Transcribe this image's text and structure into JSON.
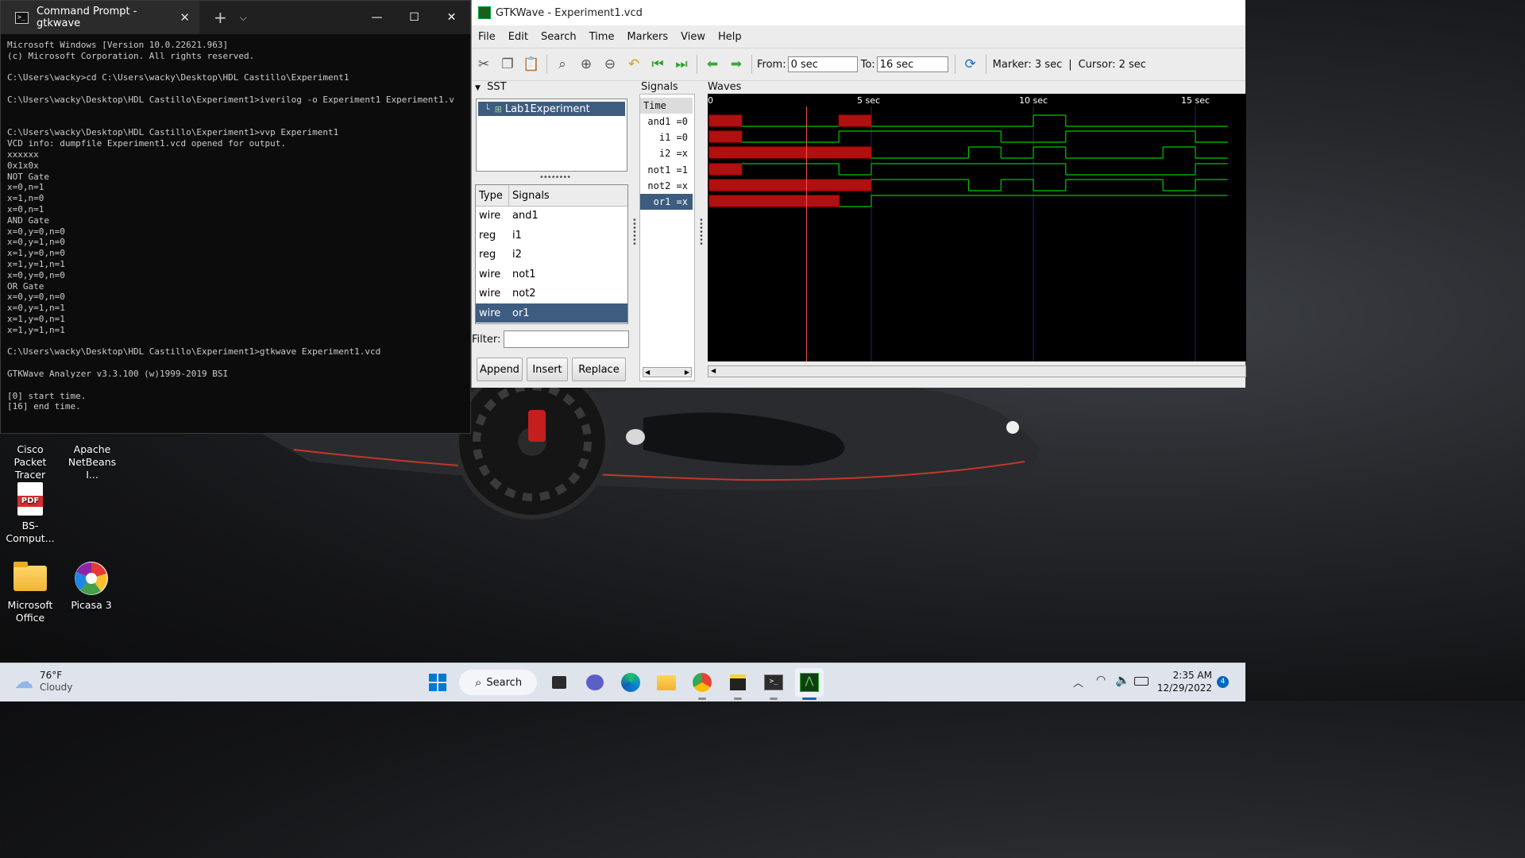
{
  "cmd": {
    "tab_title": "Command Prompt - gtkwave",
    "lines": [
      "Microsoft Windows [Version 10.0.22621.963]",
      "(c) Microsoft Corporation. All rights reserved.",
      "",
      "C:\\Users\\wacky>cd C:\\Users\\wacky\\Desktop\\HDL Castillo\\Experiment1",
      "",
      "C:\\Users\\wacky\\Desktop\\HDL Castillo\\Experiment1>iverilog -o Experiment1 Experiment1.v",
      "",
      "",
      "C:\\Users\\wacky\\Desktop\\HDL Castillo\\Experiment1>vvp Experiment1",
      "VCD info: dumpfile Experiment1.vcd opened for output.",
      "xxxxxx",
      "0x1x0x",
      "NOT Gate",
      "x=0,n=1",
      "x=1,n=0",
      "x=0,n=1",
      "AND Gate",
      "x=0,y=0,n=0",
      "x=0,y=1,n=0",
      "x=1,y=0,n=0",
      "x=1,y=1,n=1",
      "x=0,y=0,n=0",
      "OR Gate",
      "x=0,y=0,n=0",
      "x=0,y=1,n=1",
      "x=1,y=0,n=1",
      "x=1,y=1,n=1",
      "",
      "C:\\Users\\wacky\\Desktop\\HDL Castillo\\Experiment1>gtkwave Experiment1.vcd",
      "",
      "GTKWave Analyzer v3.3.100 (w)1999-2019 BSI",
      "",
      "[0] start time.",
      "[16] end time."
    ]
  },
  "gtkwave": {
    "title": "GTKWave - Experiment1.vcd",
    "menu": [
      "File",
      "Edit",
      "Search",
      "Time",
      "Markers",
      "View",
      "Help"
    ],
    "from_label": "From:",
    "from_value": "0 sec",
    "to_label": "To:",
    "to_value": "16 sec",
    "marker_text": "Marker: 3 sec",
    "cursor_text": "Cursor: 2 sec",
    "sst_label": "SST",
    "tree_item": "Lab1Experiment",
    "type_header": "Type",
    "signals_header": "Signals",
    "signal_list": [
      {
        "type": "wire",
        "name": "and1"
      },
      {
        "type": "reg",
        "name": "i1"
      },
      {
        "type": "reg",
        "name": "i2"
      },
      {
        "type": "wire",
        "name": "not1"
      },
      {
        "type": "wire",
        "name": "not2"
      },
      {
        "type": "wire",
        "name": "or1"
      }
    ],
    "filter_label": "Filter:",
    "buttons": {
      "append": "Append",
      "insert": "Insert",
      "replace": "Replace"
    },
    "signals_panel_label": "Signals",
    "time_label": "Time",
    "signal_values": [
      "and1 =0",
      "i1 =0",
      "i2 =x",
      "not1 =1",
      "not2 =x",
      "or1 =x"
    ],
    "waves_label": "Waves",
    "ruler": [
      "0",
      "5 sec",
      "10 sec",
      "15 sec"
    ],
    "colors": {
      "wave_high": "#00c800",
      "wave_x": "#c00000",
      "selection": "#3d5c80"
    }
  },
  "desktop_icons": [
    {
      "label": "Cisco Packet Tracer",
      "icon": "cisco-icon"
    },
    {
      "label": "Apache NetBeans I...",
      "icon": "netbeans-icon"
    },
    {
      "label": "BS-Comput...",
      "icon": "pdf-icon",
      "badge": "PDF"
    },
    {
      "label": "Microsoft Office",
      "icon": "folder-icon"
    },
    {
      "label": "Picasa 3",
      "icon": "picasa-icon"
    }
  ],
  "taskbar": {
    "temperature": "76°F",
    "weather": "Cloudy",
    "search": "Search",
    "time": "2:35 AM",
    "date": "12/29/2022",
    "notifications": "4"
  }
}
